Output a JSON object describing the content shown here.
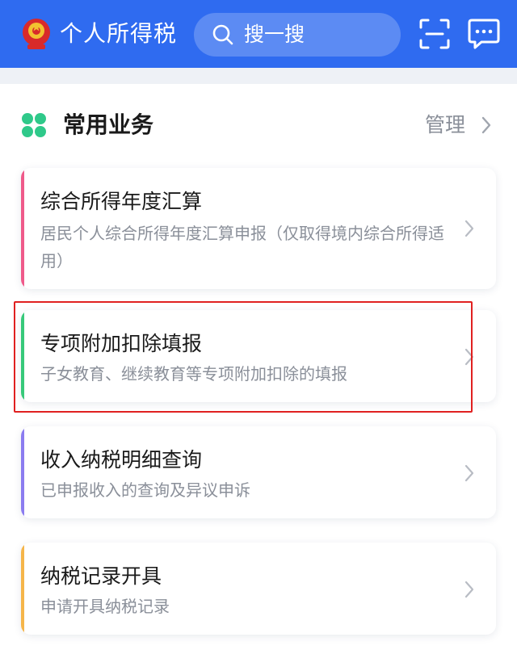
{
  "header": {
    "app_title": "个人所得税",
    "search_placeholder": "搜一搜",
    "icons": [
      "emblem-icon",
      "search-icon",
      "scan-icon",
      "message-icon"
    ]
  },
  "section": {
    "title": "常用业务",
    "manage_label": "管理"
  },
  "cards": [
    {
      "title": "综合所得年度汇算",
      "desc": "居民个人综合所得年度汇算申报（仅取得境内综合所得适用）",
      "accent": "#ef5a8a"
    },
    {
      "title": "专项附加扣除填报",
      "desc": "子女教育、继续教育等专项附加扣除的填报",
      "accent": "#37c97a"
    },
    {
      "title": "收入纳税明细查询",
      "desc": "已申报收入的查询及异议申诉",
      "accent": "#8b7cf0"
    },
    {
      "title": "纳税记录开具",
      "desc": "申请开具纳税记录",
      "accent": "#f5b54a"
    }
  ],
  "colors": {
    "header_bg": "#2f6bf0",
    "section_icon": "#2fc98a",
    "highlight_border": "#e02020"
  }
}
